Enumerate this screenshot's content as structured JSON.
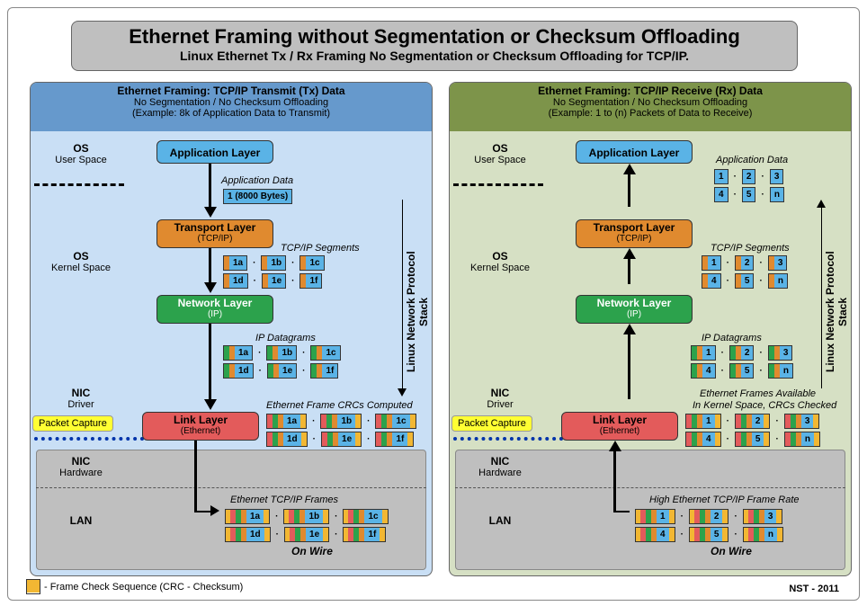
{
  "title": {
    "main": "Ethernet Framing without Segmentation or Checksum Offloading",
    "sub": "Linux Ethernet Tx / Rx Framing No Segmentation or Checksum Offloading for TCP/IP."
  },
  "tx": {
    "header1": "Ethernet Framing: TCP/IP Transmit (Tx) Data",
    "header2": "No Segmentation / No Checksum Offloading",
    "header3": "(Example: 8k of Application Data to Transmit)",
    "app_layer": "Application Layer",
    "app_data_label": "Application Data",
    "app_data_pkt": "1 (8000 Bytes)",
    "transport": "Transport Layer",
    "transport_sub": "(TCP/IP)",
    "tcp_segments_label": "TCP/IP Segments",
    "seg_ids": [
      "1a",
      "1b",
      "1c",
      "1d",
      "1e",
      "1f"
    ],
    "network": "Network Layer",
    "network_sub": "(IP)",
    "ip_label": "IP Datagrams",
    "link": "Link Layer",
    "link_sub": "(Ethernet)",
    "frame_label": "Ethernet Frame CRCs Computed",
    "wire_label": "Ethernet TCP/IP Frames",
    "onwire": "On Wire"
  },
  "rx": {
    "header1": "Ethernet Framing: TCP/IP Receive (Rx) Data",
    "header2": "No Segmentation / No Checksum Offloading",
    "header3": "(Example: 1 to (n) Packets of Data to Receive)",
    "app_layer": "Application Layer",
    "app_data_label": "Application Data",
    "app_ids": [
      "1",
      "2",
      "3",
      "4",
      "5",
      "n"
    ],
    "transport": "Transport Layer",
    "transport_sub": "(TCP/IP)",
    "tcp_segments_label": "TCP/IP Segments",
    "network": "Network Layer",
    "network_sub": "(IP)",
    "ip_label": "IP Datagrams",
    "link": "Link Layer",
    "link_sub": "(Ethernet)",
    "frame_label1": "Ethernet Frames Available",
    "frame_label2": "In Kernel Space, CRCs Checked",
    "wire_label": "High Ethernet TCP/IP Frame Rate",
    "onwire": "On Wire"
  },
  "side_labels": {
    "os_user": "OS",
    "os_user_sub": "User Space",
    "os_kernel": "OS",
    "os_kernel_sub": "Kernel Space",
    "nic_drv": "NIC",
    "nic_drv_sub": "Driver",
    "nic_hw": "NIC",
    "nic_hw_sub": "Hardware",
    "lan": "LAN",
    "pcap": "Packet Capture",
    "stack": "Linux Network Protocol Stack"
  },
  "legend": "- Frame Check Sequence (CRC - Checksum)",
  "credit": "NST - 2011"
}
